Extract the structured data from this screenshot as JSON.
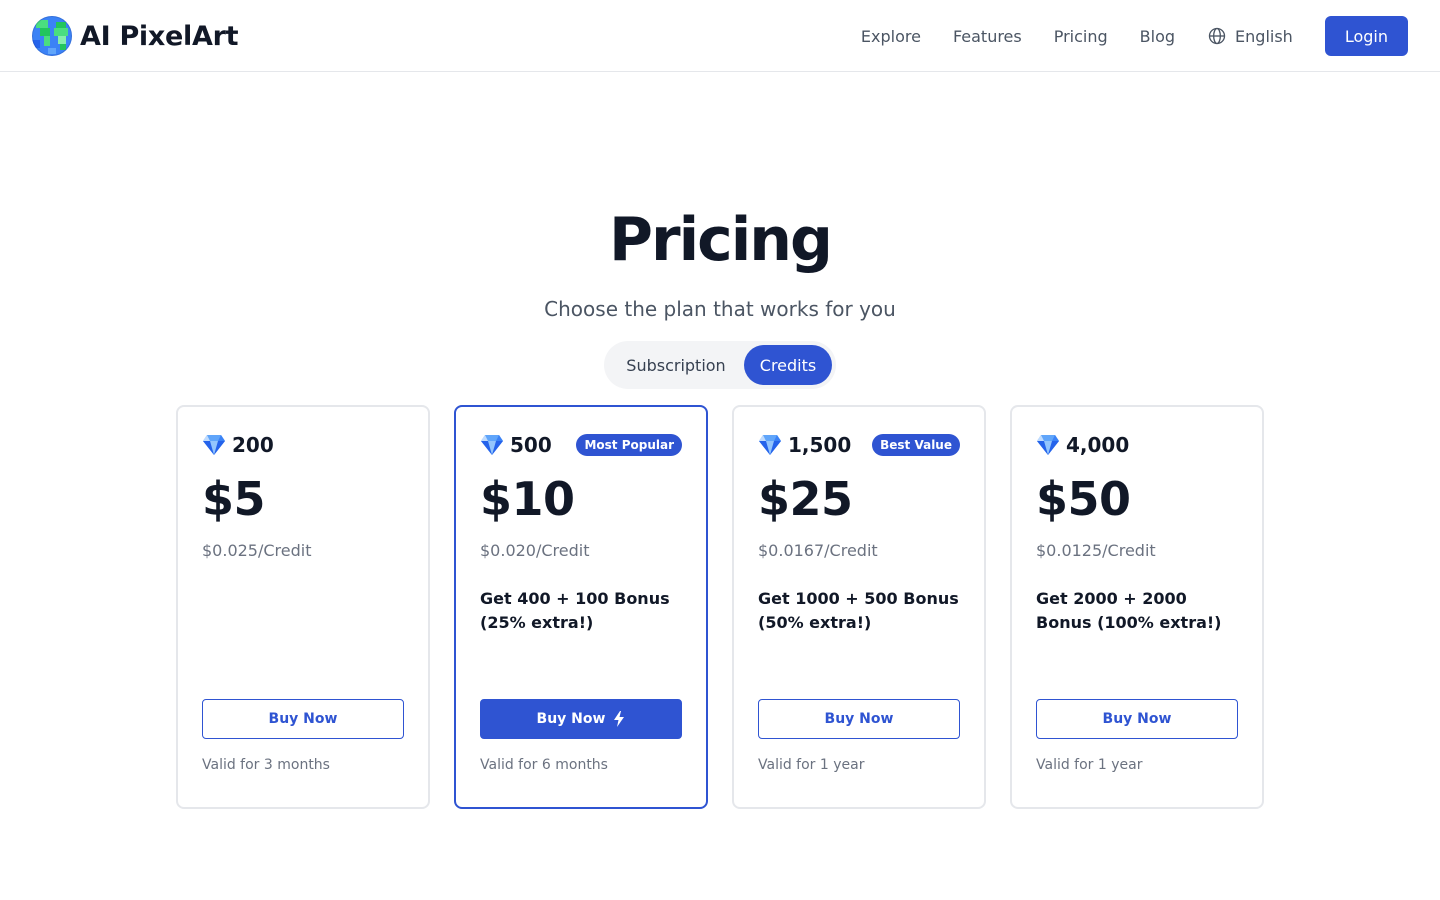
{
  "brand": {
    "name": "AI PixelArt",
    "icon": "pixel-globe-icon"
  },
  "nav": {
    "links": [
      "Explore",
      "Features",
      "Pricing",
      "Blog"
    ],
    "language": "English",
    "language_icon": "globe-icon",
    "login_label": "Login"
  },
  "hero": {
    "title": "Pricing",
    "subtitle": "Choose the plan that works for you"
  },
  "toggle": {
    "options": [
      "Subscription",
      "Credits"
    ],
    "selected": "Credits"
  },
  "colors": {
    "accent": "#2f54d2",
    "border": "#e5e7eb",
    "muted": "#6b7280"
  },
  "plans": [
    {
      "credits": "200",
      "price": "$5",
      "per_credit": "$0.025/Credit",
      "badge": "",
      "bonus": "",
      "button": "Buy Now",
      "validity": "Valid for 3 months",
      "highlighted": false
    },
    {
      "credits": "500",
      "price": "$10",
      "per_credit": "$0.020/Credit",
      "badge": "Most Popular",
      "bonus": "Get 400 + 100 Bonus (25% extra!)",
      "button": "Buy Now",
      "validity": "Valid for 6 months",
      "highlighted": true
    },
    {
      "credits": "1,500",
      "price": "$25",
      "per_credit": "$0.0167/Credit",
      "badge": "Best Value",
      "bonus": "Get 1000 + 500 Bonus (50% extra!)",
      "button": "Buy Now",
      "validity": "Valid for 1 year",
      "highlighted": false
    },
    {
      "credits": "4,000",
      "price": "$50",
      "per_credit": "$0.0125/Credit",
      "badge": "",
      "bonus": "Get 2000 + 2000 Bonus (100% extra!)",
      "button": "Buy Now",
      "validity": "Valid for 1 year",
      "highlighted": false
    }
  ]
}
